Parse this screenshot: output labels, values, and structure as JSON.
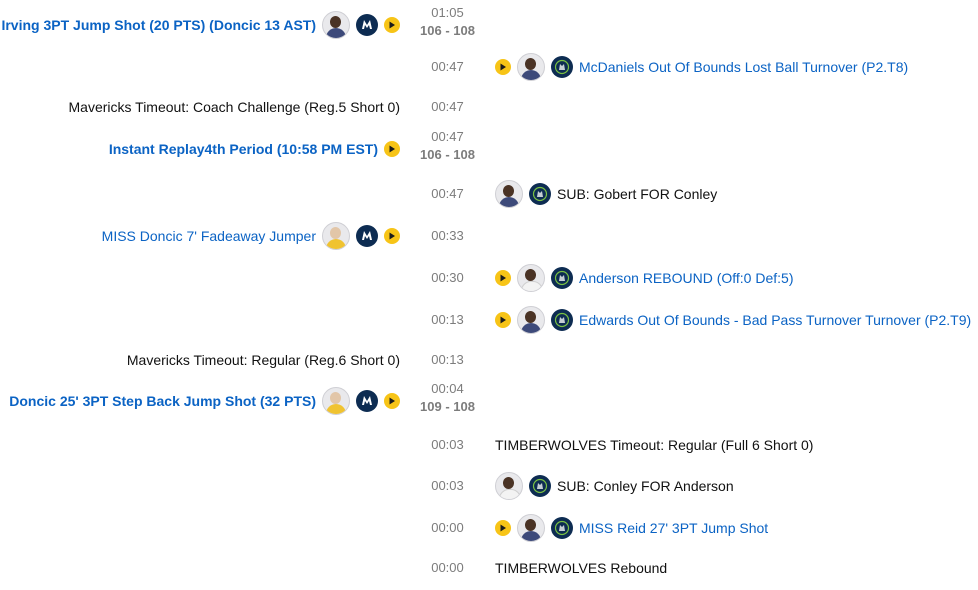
{
  "events": [
    {
      "side": "left",
      "time": "01:05",
      "score": "106 - 108",
      "text": "Irving 3PT Jump Shot (20 PTS) (Doncic 13 AST)",
      "link": true,
      "bold": true,
      "avatar": true,
      "team": "mavericks",
      "play": true
    },
    {
      "side": "right",
      "time": "00:47",
      "text": "McDaniels Out Of Bounds Lost Ball Turnover (P2.T8)",
      "link": true,
      "avatar": true,
      "team": "timberwolves",
      "play": true
    },
    {
      "side": "left",
      "time": "00:47",
      "text": "Mavericks Timeout: Coach Challenge (Reg.5 Short 0)",
      "link": false,
      "avatar": false,
      "play": false
    },
    {
      "side": "left",
      "time": "00:47",
      "score": "106 - 108",
      "text": "Instant Replay4th Period (10:58 PM EST)",
      "link": true,
      "bold": true,
      "avatar": false,
      "play": true
    },
    {
      "side": "right",
      "time": "00:47",
      "text": "SUB: Gobert FOR Conley",
      "link": false,
      "avatar": true,
      "team": "timberwolves",
      "play": false
    },
    {
      "side": "left",
      "time": "00:33",
      "text": "MISS Doncic 7' Fadeaway Jumper",
      "link": true,
      "avatar": true,
      "avatarStyle": "light",
      "team": "mavericks",
      "play": true
    },
    {
      "side": "right",
      "time": "00:30",
      "text": "Anderson REBOUND (Off:0 Def:5)",
      "link": true,
      "avatar": true,
      "avatarStyle": "white",
      "team": "timberwolves",
      "play": true
    },
    {
      "side": "right",
      "time": "00:13",
      "text": "Edwards Out Of Bounds - Bad Pass Turnover Turnover (P2.T9)",
      "link": true,
      "avatar": true,
      "team": "timberwolves",
      "play": true
    },
    {
      "side": "left",
      "time": "00:13",
      "text": "Mavericks Timeout: Regular (Reg.6 Short 0)",
      "link": false,
      "avatar": false,
      "play": false
    },
    {
      "side": "left",
      "time": "00:04",
      "score": "109 - 108",
      "text": "Doncic 25' 3PT Step Back Jump Shot (32 PTS)",
      "link": true,
      "bold": true,
      "avatar": true,
      "avatarStyle": "light",
      "team": "mavericks",
      "play": true
    },
    {
      "side": "right",
      "time": "00:03",
      "text": "TIMBERWOLVES Timeout: Regular (Full 6 Short 0)",
      "link": false,
      "avatar": false,
      "play": false
    },
    {
      "side": "right",
      "time": "00:03",
      "text": "SUB: Conley FOR Anderson",
      "link": false,
      "avatar": true,
      "avatarStyle": "white",
      "team": "timberwolves",
      "play": false
    },
    {
      "side": "right",
      "time": "00:00",
      "text": "MISS Reid 27' 3PT Jump Shot",
      "link": true,
      "avatar": true,
      "team": "timberwolves",
      "play": true
    },
    {
      "side": "right",
      "time": "00:00",
      "text": "TIMBERWOLVES Rebound",
      "link": false,
      "avatar": false,
      "play": false
    }
  ],
  "colors": {
    "link": "#0b63c4",
    "text": "#111111",
    "time": "#7c7c7c",
    "play": "#f7c417",
    "teamLogo": "#0d2c52"
  },
  "icons": {
    "play": "play-icon",
    "mavericksLogo": "mavericks-logo-icon",
    "timberwolvesLogo": "timberwolves-logo-icon",
    "avatar": "player-avatar-icon"
  }
}
